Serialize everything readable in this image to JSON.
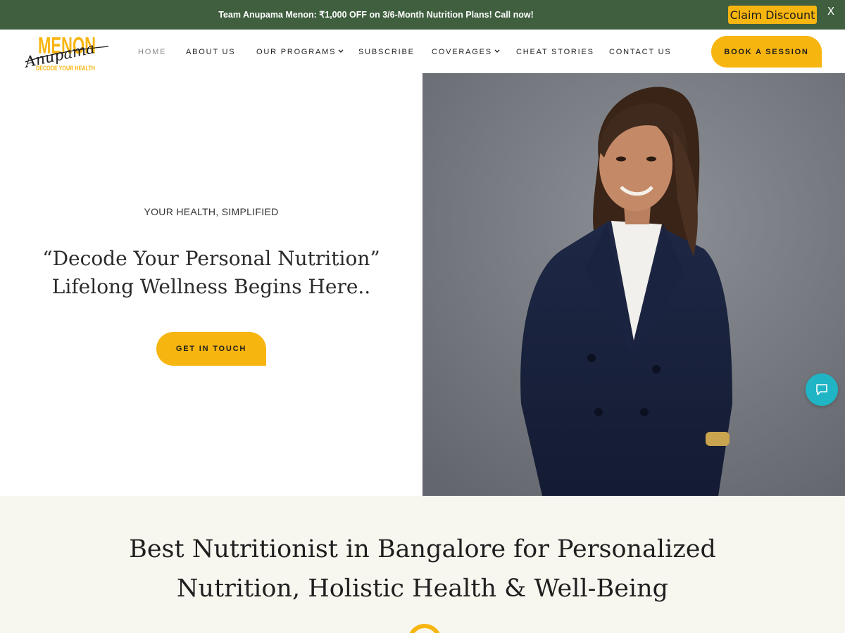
{
  "promo": {
    "text": "Team Anupama Menon: ₹1,000 OFF on 3/6-Month Nutrition Plans! Call now!",
    "claim_label": "Claim Discount",
    "close_label": "X"
  },
  "logo": {
    "top_text": "MENON",
    "script_text": "Anupama",
    "tagline": "DECODE YOUR HEALTH"
  },
  "nav": {
    "items": [
      {
        "label": "HOME",
        "active": true
      },
      {
        "label": "ABOUT US"
      },
      {
        "label": "OUR PROGRAMS",
        "dropdown": true
      },
      {
        "label": "SUBSCRIBE"
      },
      {
        "label": "COVERAGES",
        "dropdown": true
      },
      {
        "label": "CHEAT STORIES"
      },
      {
        "label": "CONTACT US"
      }
    ],
    "chevron": "⌄",
    "book_label": "BOOK A SESSION"
  },
  "hero": {
    "eyebrow": "YOUR HEALTH, SIMPLIFIED",
    "title_line1": "“Decode Your Personal Nutrition”",
    "title_line2": "Lifelong Wellness Begins Here..",
    "cta_label": "GET IN TOUCH"
  },
  "section2": {
    "title_line1": "Best Nutritionist in Bangalore for Personalized",
    "title_line2": "Nutrition, Holistic Health & Well-Being"
  },
  "colors": {
    "promo_bg": "#3f5f3f",
    "accent": "#f7b50f",
    "chat": "#1fb5c4",
    "section_bg": "#f7f6ef"
  },
  "icons": {
    "chat": "chat-bubble-icon",
    "close": "close-icon",
    "dropdown": "chevron-down-icon"
  }
}
